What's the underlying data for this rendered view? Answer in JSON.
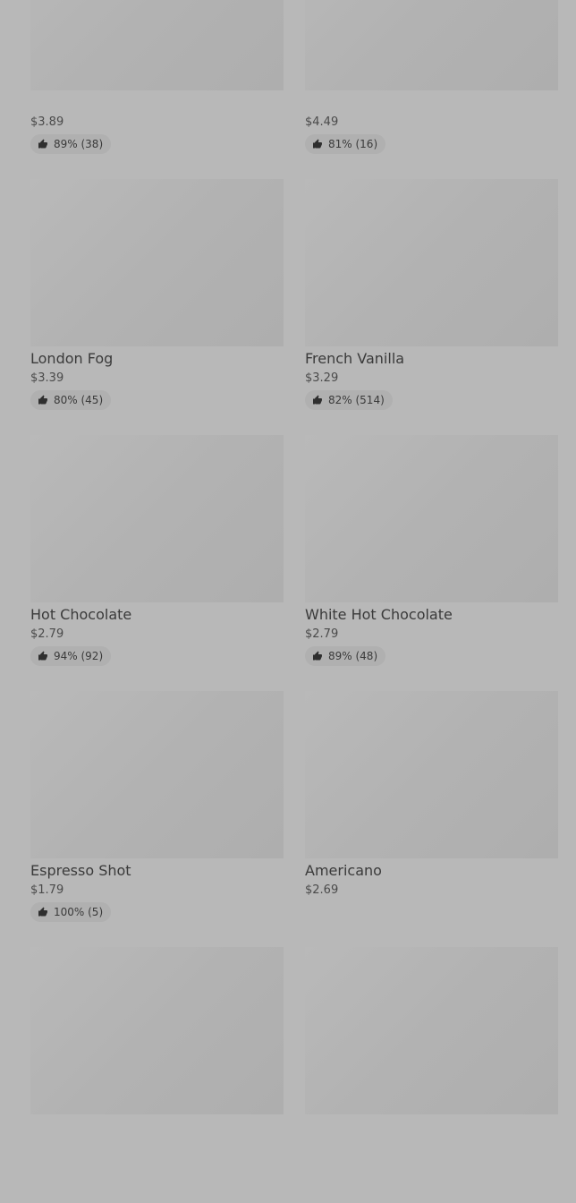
{
  "products": [
    {
      "name": "",
      "price": "$3.89",
      "rating": "89% (38)"
    },
    {
      "name": "",
      "price": "$4.49",
      "rating": "81% (16)"
    },
    {
      "name": "London Fog",
      "price": "$3.39",
      "rating": "80% (45)"
    },
    {
      "name": "French Vanilla",
      "price": "$3.29",
      "rating": "82% (514)"
    },
    {
      "name": "Hot Chocolate",
      "price": "$2.79",
      "rating": "94% (92)"
    },
    {
      "name": "White Hot Chocolate",
      "price": "$2.79",
      "rating": "89% (48)"
    },
    {
      "name": "Espresso Shot",
      "price": "$1.79",
      "rating": "100% (5)"
    },
    {
      "name": "Americano",
      "price": "$2.69",
      "rating": ""
    },
    {
      "name": "",
      "price": "",
      "rating": ""
    },
    {
      "name": "",
      "price": "",
      "rating": ""
    }
  ],
  "icons": {
    "rating_icon": "thumbs-up-icon"
  },
  "colors": {
    "background": "#b8b8b8",
    "thumb": "#b4b4b4",
    "badge": "#b0b0b0"
  }
}
